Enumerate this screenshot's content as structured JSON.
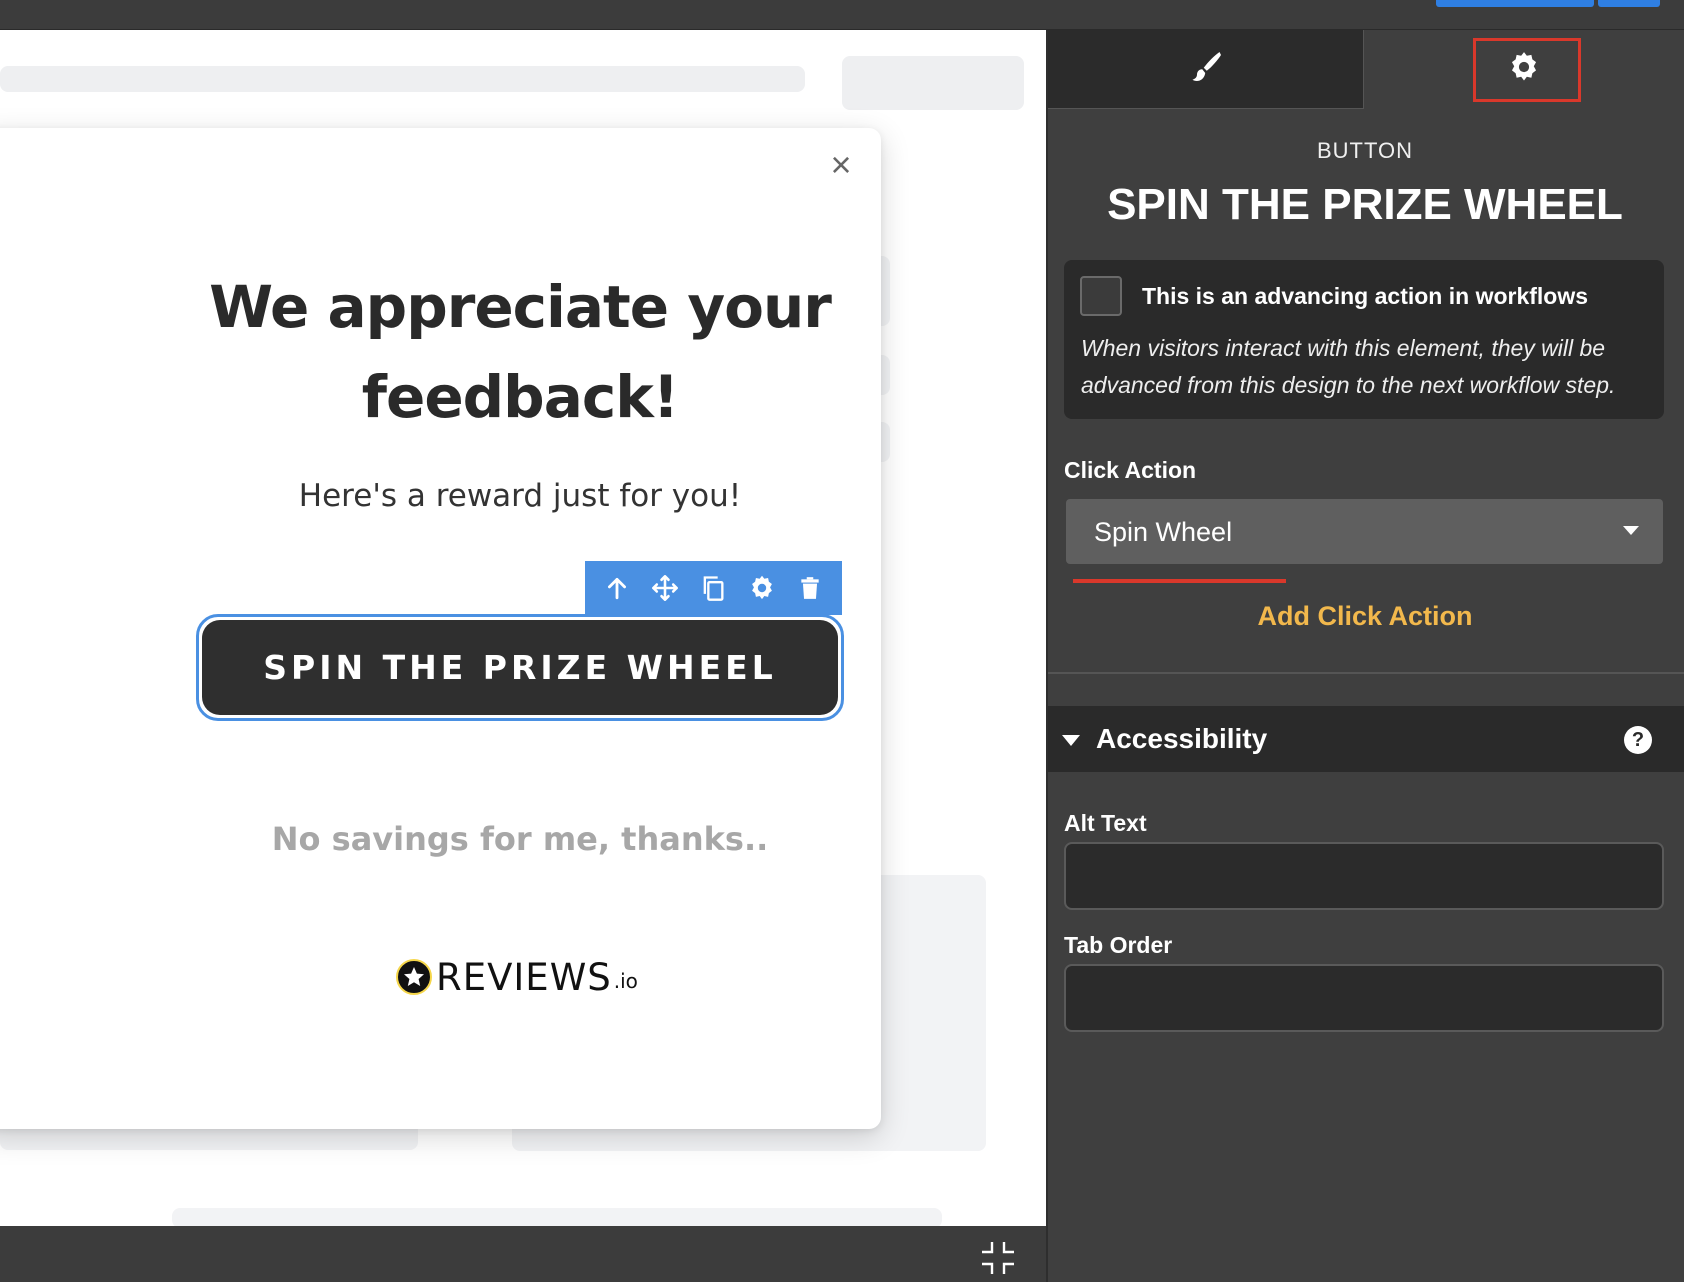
{
  "canvas": {
    "modal": {
      "close_label": "×",
      "headline_line1": "We appreciate your",
      "headline_line2": "feedback!",
      "subline": "Here's a reward just for you!",
      "cta_button": "SPIN THE PRIZE WHEEL",
      "decline_link": "No savings for me, thanks..",
      "brand_wordmark": "REVIEWS",
      "brand_suffix": ".io"
    },
    "element_toolbar": {
      "icons": [
        "arrow-up-icon",
        "move-icon",
        "copy-icon",
        "gear-icon",
        "trash-icon"
      ]
    }
  },
  "panel": {
    "tabs": [
      "brush-icon",
      "gear-icon"
    ],
    "active_tab": "settings",
    "element_type": "BUTTON",
    "element_name": "SPIN THE PRIZE WHEEL",
    "advancing_action": {
      "checked": false,
      "label": "This is an advancing action in workflows",
      "description": "When visitors interact with this element, they will be advanced from this design to the next workflow step."
    },
    "click_action": {
      "label": "Click Action",
      "selected": "Spin Wheel",
      "add_label": "Add Click Action"
    },
    "accessibility": {
      "title": "Accessibility",
      "help_glyph": "?",
      "alt_text_label": "Alt Text",
      "alt_text_value": "",
      "tab_order_label": "Tab Order",
      "tab_order_value": ""
    }
  },
  "colors": {
    "accent_blue": "#4a90e2",
    "highlight_red": "#d9382b",
    "action_orange": "#f2b84c",
    "panel_bg": "#3f3f3f"
  }
}
